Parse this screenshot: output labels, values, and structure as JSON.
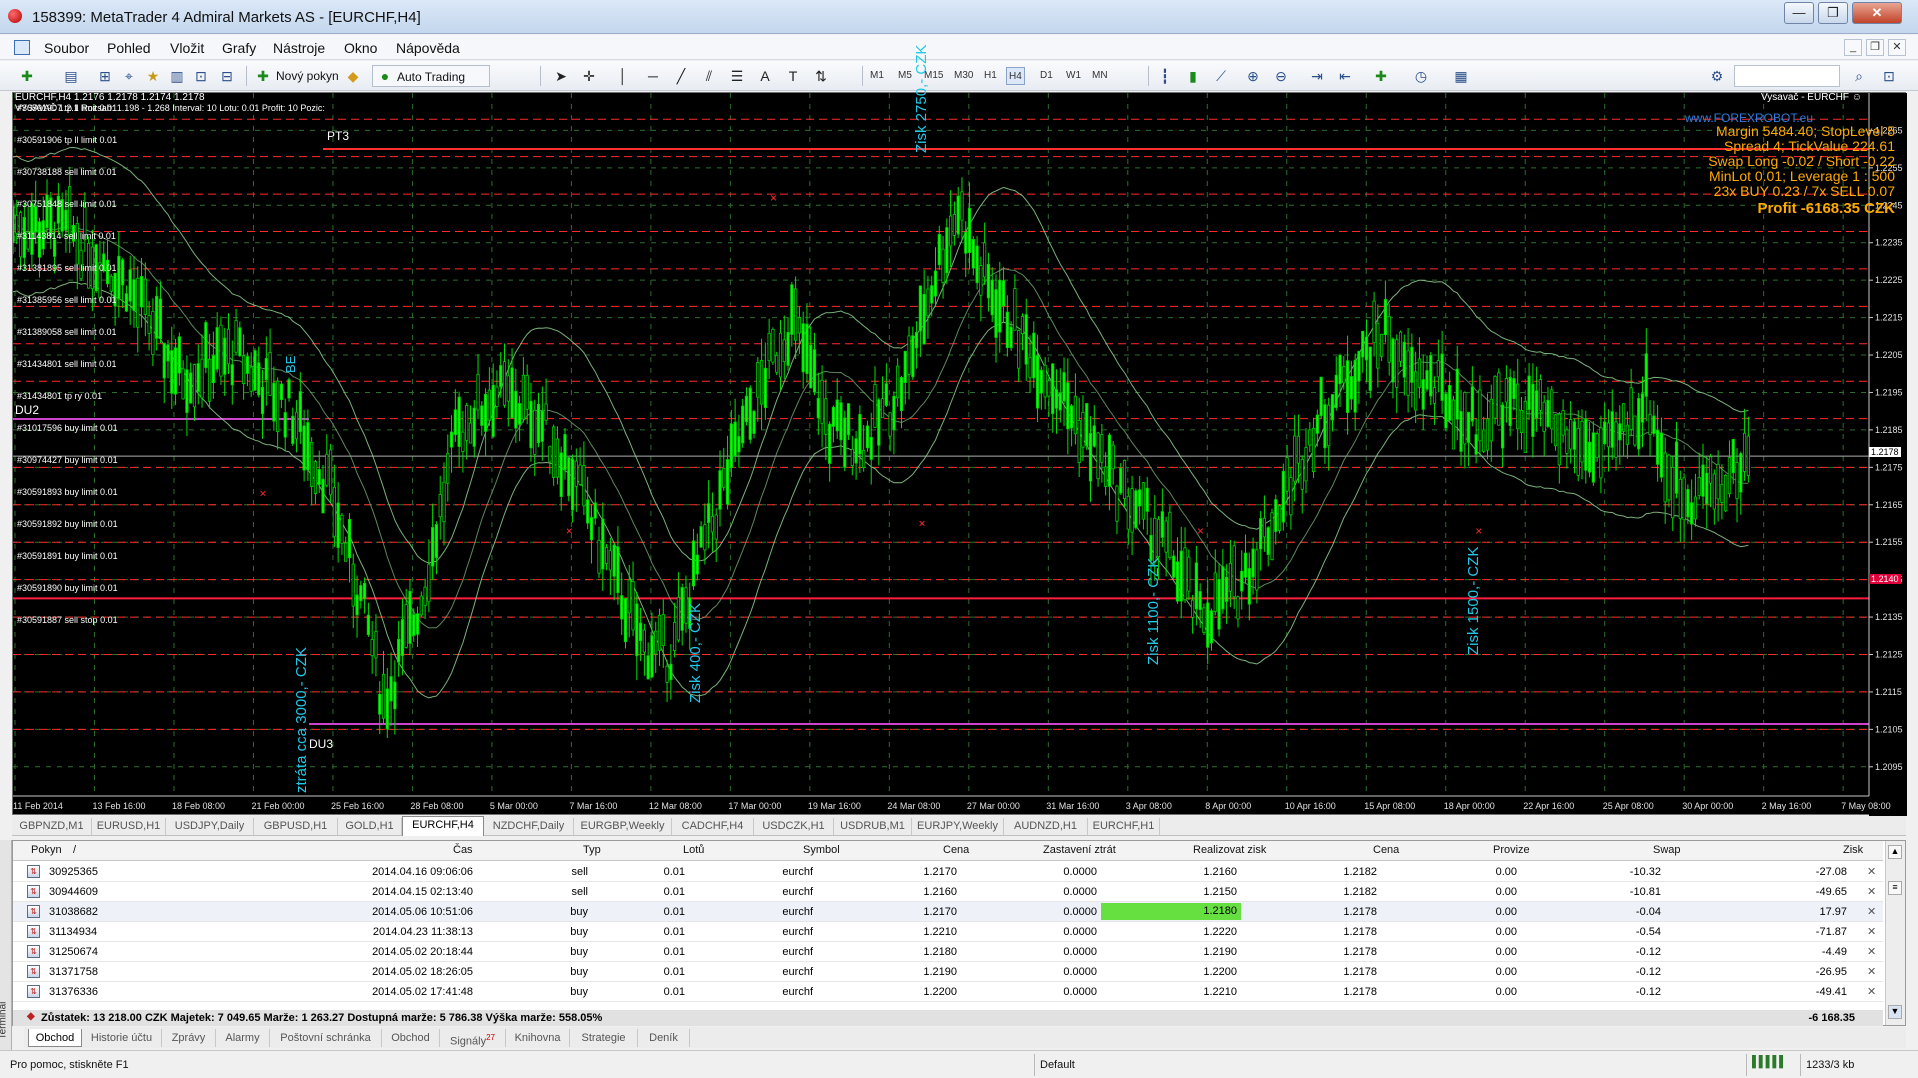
{
  "window": {
    "title": "158399: MetaTrader 4 Admiral Markets AS - [EURCHF,H4]",
    "minimize": "—",
    "maximize": "❐",
    "close": "✕"
  },
  "menu": {
    "items": [
      "Soubor",
      "Pohled",
      "Vložit",
      "Grafy",
      "Nástroje",
      "Okno",
      "Nápověda"
    ]
  },
  "toolbar": {
    "new_order": "Nový pokyn",
    "auto_trading": "Auto Trading",
    "timeframes": [
      "M1",
      "M5",
      "M15",
      "M30",
      "H1",
      "H4",
      "D1",
      "W1",
      "MN"
    ],
    "active_timeframe": "H4"
  },
  "chart": {
    "symbol_line": "EURCHF,H4  1.2176 1.2178 1.2174 1.2178",
    "indicator_line": "VYSAVAČ 1.2.1    Rozsah: 1.198 - 1.268    Interval: 10    Lotu: 0.01    Profit: 10    Pozic:",
    "ea_label": "Vysavač - EURCHF ☺",
    "info_panel": {
      "site": "www.FOREXROBOT.eu",
      "margin": "Margin 5484.40; StopLevel 5",
      "spread": "Spread 4; TickValue 224.61",
      "swap": "Swap Long -0.02 / Short -0.22",
      "minlot": "MinLot 0.01; Leverage 1 : 500",
      "trades": "23x BUY 0.23 / 7x SELL 0.07",
      "profit": "Profit -6168.35 CZK"
    },
    "order_labels": [
      "#30591907 tp ll limit 0.01",
      "#30591906 tp ll limit 0.01",
      "#30738188 sell limit 0.01",
      "#30751848 sell limit 0.01",
      "#31143814 sell limit 0.01",
      "#31381895 sell limit 0.01",
      "#31385956 sell limit 0.01",
      "#31389058 sell limit 0.01",
      "#31434801 sell limit 0.01",
      "#31434801 tp ry 0.01",
      "#31017596 buy limit 0.01",
      "#30974427 buy limit 0.01",
      "#30591893 buy limit 0.01",
      "#30591892 buy limit 0.01",
      "#30591891 buy limit 0.01",
      "#30591890 buy limit 0.01",
      "#30591887 sell stop 0.01"
    ],
    "line_labels": {
      "pt3": "PT3",
      "du2": "DU2",
      "du3": "DU3",
      "be": "BE"
    },
    "annotations": [
      "Zisk 2750,- CZK",
      "Zisk 400,- CZK",
      "Zisk 1100,- CZK",
      "Zisk 1500,- CZK",
      "ztráta cca 3000,- CZK"
    ],
    "current_price_label": "1.2178",
    "buy_limit_price_label": "1.2140",
    "colors": {
      "background": "#000000",
      "bull_candle": "#00d000",
      "bear_candle": "#00ff00",
      "grid": "#2c6e2c",
      "sell_lines": "#ff2a2a",
      "annotation": "#22c8e8",
      "info": "#ffaa00",
      "pt_lines": "#cc44cc"
    }
  },
  "chart_data": {
    "type": "candlestick",
    "symbol": "EURCHF",
    "timeframe": "H4",
    "x_ticks": [
      "11 Feb 2014",
      "13 Feb 16:00",
      "18 Feb 08:00",
      "21 Feb 00:00",
      "25 Feb 16:00",
      "28 Feb 08:00",
      "5 Mar 00:00",
      "7 Mar 16:00",
      "12 Mar 08:00",
      "17 Mar 00:00",
      "19 Mar 16:00",
      "24 Mar 08:00",
      "27 Mar 00:00",
      "31 Mar 16:00",
      "3 Apr 08:00",
      "8 Apr 00:00",
      "10 Apr 16:00",
      "15 Apr 08:00",
      "18 Apr 00:00",
      "22 Apr 16:00",
      "25 Apr 08:00",
      "30 Apr 00:00",
      "2 May 16:00",
      "7 May 08:00"
    ],
    "y_ticks": [
      "1.2265",
      "1.2255",
      "1.2245",
      "1.2235",
      "1.2225",
      "1.2215",
      "1.2205",
      "1.2195",
      "1.2185",
      "1.2175",
      "1.2165",
      "1.2155",
      "1.2145",
      "1.2135",
      "1.2125",
      "1.2115",
      "1.2105",
      "1.2095"
    ],
    "y_range": [
      1.2088,
      1.2275
    ],
    "price_path": [
      [
        0,
        1.224
      ],
      [
        0.03,
        1.2238
      ],
      [
        0.06,
        1.2225
      ],
      [
        0.09,
        1.22
      ],
      [
        0.12,
        1.2205
      ],
      [
        0.15,
        1.219
      ],
      [
        0.17,
        1.217
      ],
      [
        0.19,
        1.2135
      ],
      [
        0.2,
        1.2112
      ],
      [
        0.22,
        1.214
      ],
      [
        0.24,
        1.2185
      ],
      [
        0.26,
        1.2195
      ],
      [
        0.28,
        1.219
      ],
      [
        0.3,
        1.2175
      ],
      [
        0.32,
        1.215
      ],
      [
        0.34,
        1.2127
      ],
      [
        0.355,
        1.2125
      ],
      [
        0.37,
        1.215
      ],
      [
        0.39,
        1.218
      ],
      [
        0.41,
        1.2205
      ],
      [
        0.42,
        1.2215
      ],
      [
        0.44,
        1.2185
      ],
      [
        0.46,
        1.2182
      ],
      [
        0.48,
        1.2198
      ],
      [
        0.5,
        1.2232
      ],
      [
        0.51,
        1.2245
      ],
      [
        0.52,
        1.2228
      ],
      [
        0.54,
        1.2212
      ],
      [
        0.56,
        1.2198
      ],
      [
        0.58,
        1.2182
      ],
      [
        0.6,
        1.2167
      ],
      [
        0.62,
        1.2155
      ],
      [
        0.64,
        1.2135
      ],
      [
        0.66,
        1.2143
      ],
      [
        0.68,
        1.2162
      ],
      [
        0.7,
        1.2185
      ],
      [
        0.72,
        1.22
      ],
      [
        0.74,
        1.2212
      ],
      [
        0.75,
        1.22
      ],
      [
        0.77,
        1.2195
      ],
      [
        0.79,
        1.2185
      ],
      [
        0.8,
        1.2192
      ],
      [
        0.82,
        1.219
      ],
      [
        0.83,
        1.2185
      ],
      [
        0.85,
        1.218
      ],
      [
        0.86,
        1.2178
      ],
      [
        0.88,
        1.2195
      ],
      [
        0.89,
        1.2175
      ],
      [
        0.9,
        1.2168
      ],
      [
        0.92,
        1.217
      ],
      [
        0.935,
        1.2178
      ]
    ],
    "horizontal_levels": [
      1.2268,
      1.2258,
      1.2248,
      1.2238,
      1.2228,
      1.2218,
      1.2208,
      1.2198,
      1.2188,
      1.2175,
      1.2165,
      1.2155,
      1.2145,
      1.214,
      1.2135,
      1.2125,
      1.2115,
      1.2105
    ]
  },
  "chart_tabs": {
    "items": [
      "GBPNZD,M1",
      "EURUSD,H1",
      "USDJPY,Daily",
      "GBPUSD,H1",
      "GOLD,H1",
      "EURCHF,H4",
      "NZDCHF,Daily",
      "EURGBP,Weekly",
      "CADCHF,H4",
      "USDCZK,H1",
      "USDRUB,M1",
      "EURJPY,Weekly",
      "AUDNZD,H1",
      "EURCHF,H1"
    ],
    "active": "EURCHF,H4"
  },
  "orders": {
    "columns": [
      "Pokyn",
      "/",
      "Čas",
      "Typ",
      "Lotů",
      "Symbol",
      "Cena",
      "Zastavení ztrát",
      "Realizovat zisk",
      "Cena",
      "Provize",
      "Swap",
      "Zisk"
    ],
    "rows": [
      {
        "ticket": "30925365",
        "time": "2014.04.16 09:06:06",
        "type": "sell",
        "lots": "0.01",
        "symbol": "eurchf",
        "price": "1.2170",
        "sl": "0.0000",
        "tp": "1.2160",
        "current": "1.2182",
        "commission": "0.00",
        "swap": "-10.32",
        "profit": "-27.08"
      },
      {
        "ticket": "30944609",
        "time": "2014.04.15 02:13:40",
        "type": "sell",
        "lots": "0.01",
        "symbol": "eurchf",
        "price": "1.2160",
        "sl": "0.0000",
        "tp": "1.2150",
        "current": "1.2182",
        "commission": "0.00",
        "swap": "-10.81",
        "profit": "-49.65"
      },
      {
        "ticket": "31038682",
        "time": "2014.05.06 10:51:06",
        "type": "buy",
        "lots": "0.01",
        "symbol": "eurchf",
        "price": "1.2170",
        "sl": "0.0000",
        "tp": "1.2180",
        "current": "1.2178",
        "commission": "0.00",
        "swap": "-0.04",
        "profit": "17.97"
      },
      {
        "ticket": "31134934",
        "time": "2014.04.23 11:38:13",
        "type": "buy",
        "lots": "0.01",
        "symbol": "eurchf",
        "price": "1.2210",
        "sl": "0.0000",
        "tp": "1.2220",
        "current": "1.2178",
        "commission": "0.00",
        "swap": "-0.54",
        "profit": "-71.87"
      },
      {
        "ticket": "31250674",
        "time": "2014.05.02 20:18:44",
        "type": "buy",
        "lots": "0.01",
        "symbol": "eurchf",
        "price": "1.2180",
        "sl": "0.0000",
        "tp": "1.2190",
        "current": "1.2178",
        "commission": "0.00",
        "swap": "-0.12",
        "profit": "-4.49"
      },
      {
        "ticket": "31371758",
        "time": "2014.05.02 18:26:05",
        "type": "buy",
        "lots": "0.01",
        "symbol": "eurchf",
        "price": "1.2190",
        "sl": "0.0000",
        "tp": "1.2200",
        "current": "1.2178",
        "commission": "0.00",
        "swap": "-0.12",
        "profit": "-26.95"
      },
      {
        "ticket": "31376336",
        "time": "2014.05.02 17:41:48",
        "type": "buy",
        "lots": "0.01",
        "symbol": "eurchf",
        "price": "1.2200",
        "sl": "0.0000",
        "tp": "1.2210",
        "current": "1.2178",
        "commission": "0.00",
        "swap": "-0.12",
        "profit": "-49.41"
      }
    ],
    "highlight_row": 2,
    "highlight_color": "#66e040",
    "summary": "Zůstatek: 13 218.00 CZK  Majetek: 7 049.65  Marže: 1 263.27  Dostupná marže: 5 786.38  Výška marže: 558.05%",
    "summary_total": "-6 168.35"
  },
  "terminal_label": "Terminál",
  "terminal_tabs": {
    "items": [
      "Obchod",
      "Historie účtu",
      "Zprávy",
      "Alarmy",
      "Poštovní schránka",
      "Obchod",
      "Signály",
      "Knihovna",
      "Strategie",
      "Deník"
    ],
    "signals_badge": "27",
    "active": "Obchod"
  },
  "statusbar": {
    "help": "Pro pomoc, stiskněte F1",
    "profile": "Default",
    "traffic": "1233/3 kb"
  }
}
